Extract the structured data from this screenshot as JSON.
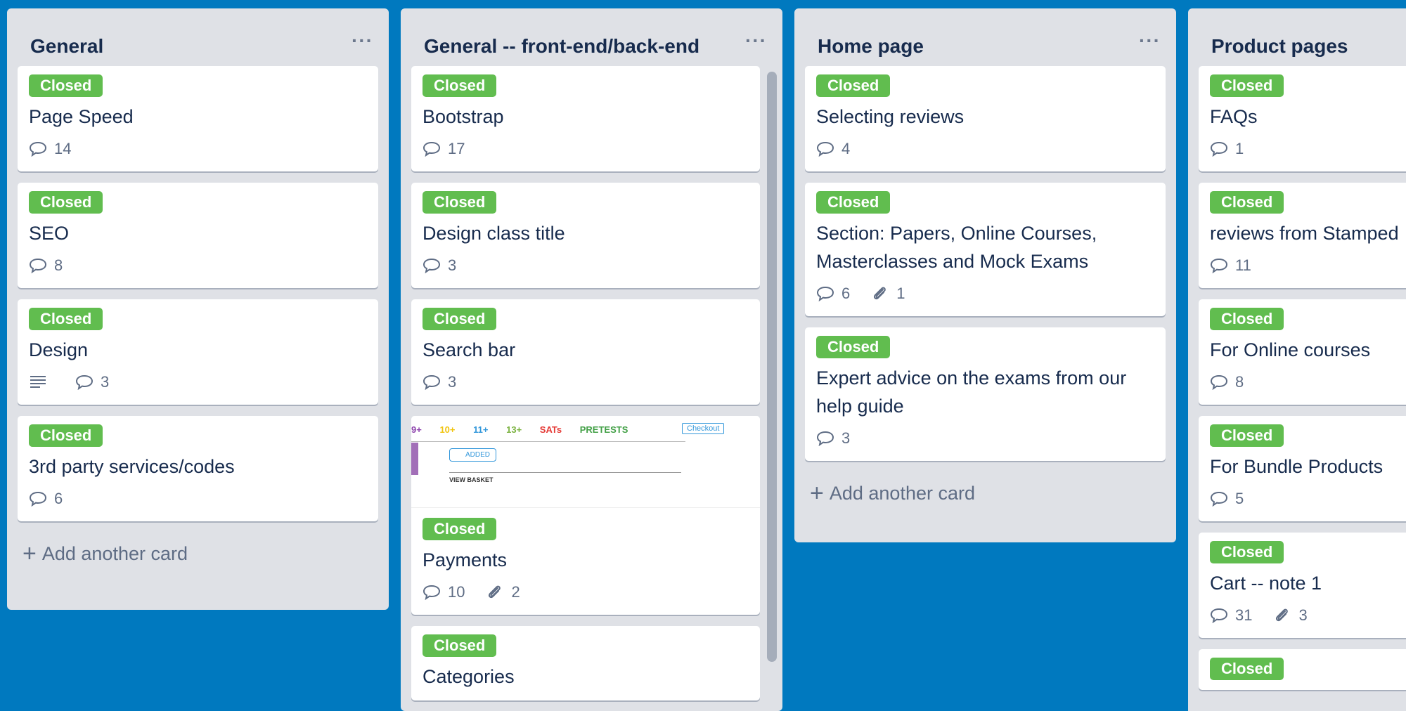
{
  "colors": {
    "board_bg": "#0079bf",
    "list_bg": "#dfe1e6",
    "label_green": "#61bd4f",
    "title_text": "#172b4d",
    "meta_text": "#5e6c84"
  },
  "menu_glyph": "···",
  "add_card_label": "Add another card",
  "lists": [
    {
      "title": "General",
      "cards": [
        {
          "label": "Closed",
          "title": "Page Speed",
          "comments": "14"
        },
        {
          "label": "Closed",
          "title": "SEO",
          "comments": "8"
        },
        {
          "label": "Closed",
          "title": "Design",
          "comments": "3",
          "has_description": true
        },
        {
          "label": "Closed",
          "title": "3rd party services/codes",
          "comments": "6"
        }
      ]
    },
    {
      "title": "General -- front-end/back-end",
      "cards": [
        {
          "label": "Closed",
          "title": "Bootstrap",
          "comments": "17"
        },
        {
          "label": "Closed",
          "title": "Design class title",
          "comments": "3"
        },
        {
          "label": "Closed",
          "title": "Search bar",
          "comments": "3"
        },
        {
          "label": "Closed",
          "title": "Payments",
          "comments": "10",
          "attachments": "2",
          "cover": {
            "tabs": [
              "9+",
              "10+",
              "11+",
              "13+",
              "SATs",
              "PRETESTS"
            ],
            "button": "Checkout",
            "added": "ADDED",
            "view_basket": "VIEW BASKET"
          }
        },
        {
          "label": "Closed",
          "title": "Categories"
        }
      ]
    },
    {
      "title": "Home page",
      "cards": [
        {
          "label": "Closed",
          "title": "Selecting reviews",
          "comments": "4"
        },
        {
          "label": "Closed",
          "title": "Section: Papers, Online Courses, Masterclasses and Mock Exams",
          "comments": "6",
          "attachments": "1"
        },
        {
          "label": "Closed",
          "title": "Expert advice on the exams from our help guide",
          "comments": "3"
        }
      ]
    },
    {
      "title": "Product pages",
      "cards": [
        {
          "label": "Closed",
          "title": "FAQs",
          "comments": "1"
        },
        {
          "label": "Closed",
          "title": "reviews from Stamped",
          "comments": "11"
        },
        {
          "label": "Closed",
          "title": "For Online courses",
          "comments": "8"
        },
        {
          "label": "Closed",
          "title": "For Bundle Products",
          "comments": "5"
        },
        {
          "label": "Closed",
          "title": "Cart -- note 1",
          "comments": "31",
          "attachments": "3"
        },
        {
          "label": "Closed",
          "title": ""
        }
      ]
    }
  ]
}
